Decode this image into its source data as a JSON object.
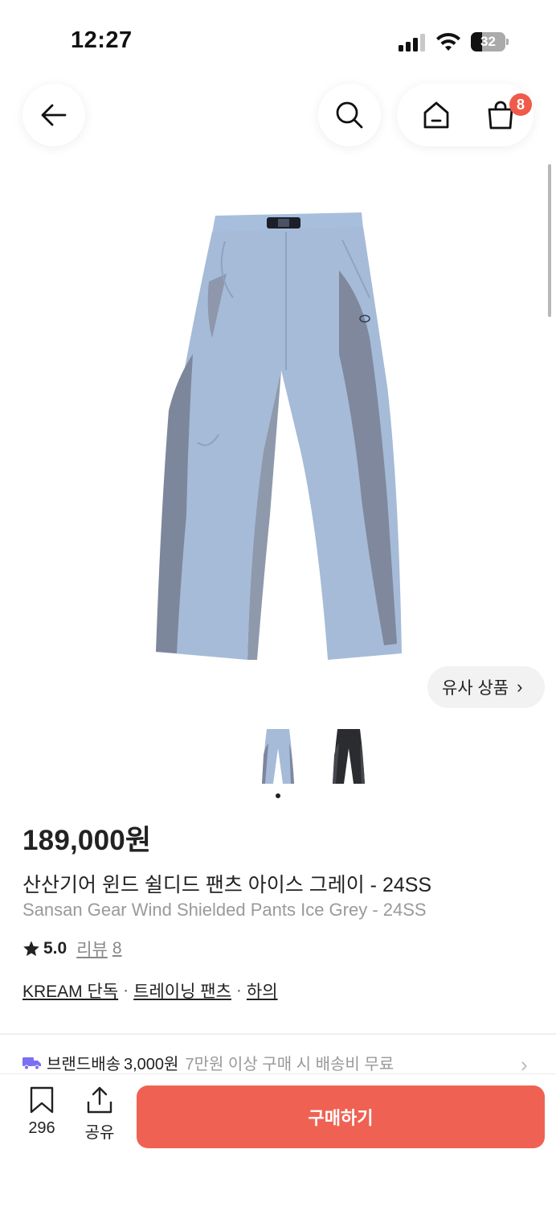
{
  "status_bar": {
    "time": "12:27",
    "battery_level": "32",
    "battery_fraction": 0.32
  },
  "nav": {
    "cart_count": "8"
  },
  "gallery": {
    "similar_label": "유사 상품",
    "similar_chevron": "›",
    "image_count": 2,
    "current_index": 0
  },
  "product": {
    "price": "189,000원",
    "name_ko": "산산기어 윈드 쉴디드 팬츠 아이스 그레이 - 24SS",
    "name_en": "Sansan Gear Wind Shielded Pants Ice Grey - 24SS",
    "rating": "5.0",
    "review_label": "리뷰",
    "review_count": "8"
  },
  "tags": {
    "brand": "KREAM 단독",
    "sep1": "·",
    "category": "트레이닝 팬츠",
    "sep2": "·",
    "parent": "하의"
  },
  "shipping": {
    "label": "브랜드배송",
    "fee": "3,000원",
    "note": "7만원 이상 구매 시 배송비 무료",
    "chevron": "›"
  },
  "bottom_bar": {
    "bookmark_count": "296",
    "share_label": "공유",
    "buy_label": "구매하기"
  },
  "colors": {
    "accent": "#ef6253",
    "badge": "#ef5a4a",
    "truck": "#7b6ff2"
  },
  "icons": [
    "back-arrow-icon",
    "search-icon",
    "home-icon",
    "shopping-bag-icon",
    "star-icon",
    "truck-icon",
    "bookmark-icon",
    "share-icon",
    "chevron-right-icon"
  ]
}
